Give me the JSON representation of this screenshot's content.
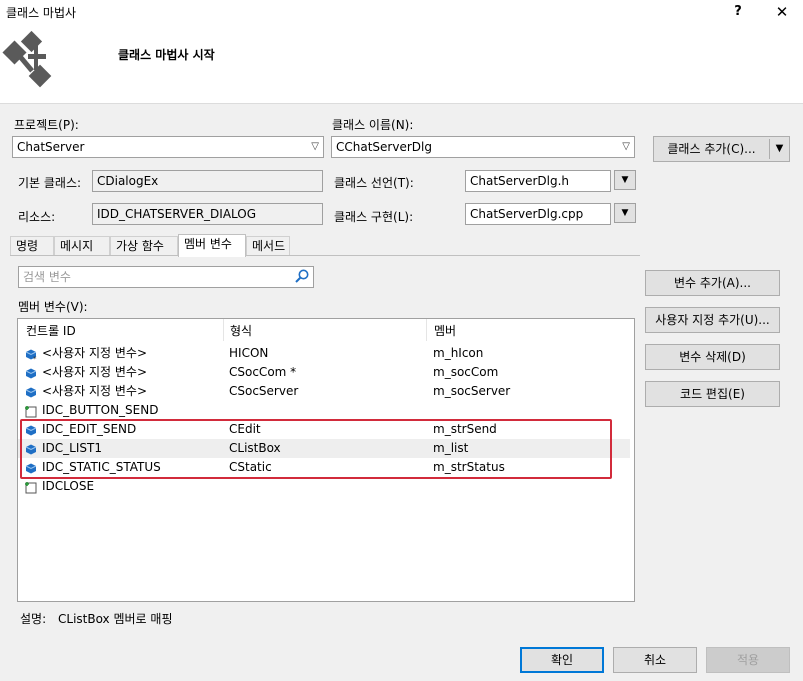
{
  "window": {
    "title": "클래스 마법사",
    "help_glyph": "?",
    "close_glyph": "✕",
    "header_title": "클래스 마법사 시작"
  },
  "project": {
    "label": "프로젝트(P):",
    "value": "ChatServer"
  },
  "class_name": {
    "label": "클래스 이름(N):",
    "value": "CChatServerDlg"
  },
  "add_class_button": "클래스 추가(C)...",
  "base_class": {
    "label": "기본 클래스:",
    "value": "CDialogEx"
  },
  "resource": {
    "label": "리소스:",
    "value": "IDD_CHATSERVER_DIALOG"
  },
  "class_declaration": {
    "label": "클래스 선언(T):",
    "value": "ChatServerDlg.h"
  },
  "class_implementation": {
    "label": "클래스 구현(L):",
    "value": "ChatServerDlg.cpp"
  },
  "tabs": [
    {
      "label": "명령"
    },
    {
      "label": "메시지"
    },
    {
      "label": "가상 함수"
    },
    {
      "label": "멤버 변수"
    },
    {
      "label": "메서드"
    }
  ],
  "search": {
    "placeholder": "검색 변수"
  },
  "member_list": {
    "label": "멤버 변수(V):",
    "columns": [
      "컨트롤 ID",
      "형식",
      "멤버"
    ],
    "rows": [
      {
        "id": "<사용자 지정 변수>",
        "type": "HICON",
        "member": "m_hIcon",
        "icon": "custom-variable-icon"
      },
      {
        "id": "<사용자 지정 변수>",
        "type": "CSocCom *",
        "member": "m_socCom",
        "icon": "variable-icon"
      },
      {
        "id": "<사용자 지정 변수>",
        "type": "CSocServer",
        "member": "m_socServer",
        "icon": "variable-icon"
      },
      {
        "id": "IDC_BUTTON_SEND",
        "type": "",
        "member": "",
        "icon": "control-icon"
      },
      {
        "id": "IDC_EDIT_SEND",
        "type": "CEdit",
        "member": "m_strSend",
        "icon": "variable-icon"
      },
      {
        "id": "IDC_LIST1",
        "type": "CListBox",
        "member": "m_list",
        "icon": "variable-icon"
      },
      {
        "id": "IDC_STATIC_STATUS",
        "type": "CStatic",
        "member": "m_strStatus",
        "icon": "variable-icon"
      },
      {
        "id": "IDCLOSE",
        "type": "",
        "member": "",
        "icon": "control-icon"
      }
    ]
  },
  "side_buttons": {
    "add_variable": "변수 추가(A)...",
    "add_custom": "사용자 지정 추가(U)...",
    "delete_variable": "변수 삭제(D)",
    "edit_code": "코드 편집(E)"
  },
  "description": {
    "label": "설명:",
    "value": "CListBox 멤버로 매핑"
  },
  "footer": {
    "ok": "확인",
    "cancel": "취소",
    "apply": "적용"
  },
  "colors": {
    "highlight_border": "#d22b3b",
    "primary_border": "#0078d7",
    "icon_blue": "#1f6fc5"
  }
}
